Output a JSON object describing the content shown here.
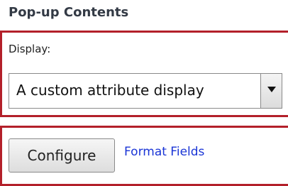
{
  "title": "Pop-up Contents",
  "display": {
    "label": "Display:",
    "selected_value": "A custom attribute display"
  },
  "actions": {
    "configure_label": "Configure",
    "format_fields_label": "Format Fields"
  },
  "colors": {
    "highlight_border": "#b3202a",
    "link": "#1a35d6"
  }
}
